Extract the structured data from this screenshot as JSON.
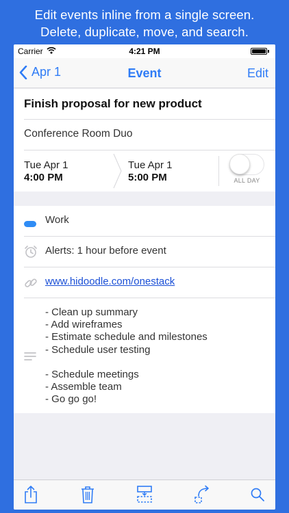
{
  "banner": {
    "line1": "Edit events inline from a single screen.",
    "line2": "Delete, duplicate, move, and search."
  },
  "status": {
    "carrier": "Carrier",
    "time": "4:21 PM"
  },
  "nav": {
    "back_label": "Apr 1",
    "title": "Event",
    "edit_label": "Edit"
  },
  "event": {
    "title": "Finish proposal for new product",
    "location": "Conference Room Duo",
    "start_date": "Tue Apr 1",
    "start_time": "4:00 PM",
    "end_date": "Tue Apr 1",
    "end_time": "5:00 PM",
    "all_day_label": "ALL DAY",
    "all_day": false,
    "calendar": "Work",
    "calendar_color": "#2f8cf5",
    "alert": "Alerts: 1 hour before event",
    "url": "www.hidoodle.com/onestack",
    "notes": "- Clean up summary\n- Add wireframes\n- Estimate schedule and milestones\n- Schedule user testing\n\n- Schedule meetings\n- Assemble team\n- Go go go!"
  },
  "toolbar": {
    "icons": [
      "share-icon",
      "trash-icon",
      "duplicate-icon",
      "move-icon",
      "search-icon"
    ]
  },
  "colors": {
    "background": "#2f6fe0",
    "accent": "#2f7cf6",
    "link": "#1a4fd6"
  }
}
